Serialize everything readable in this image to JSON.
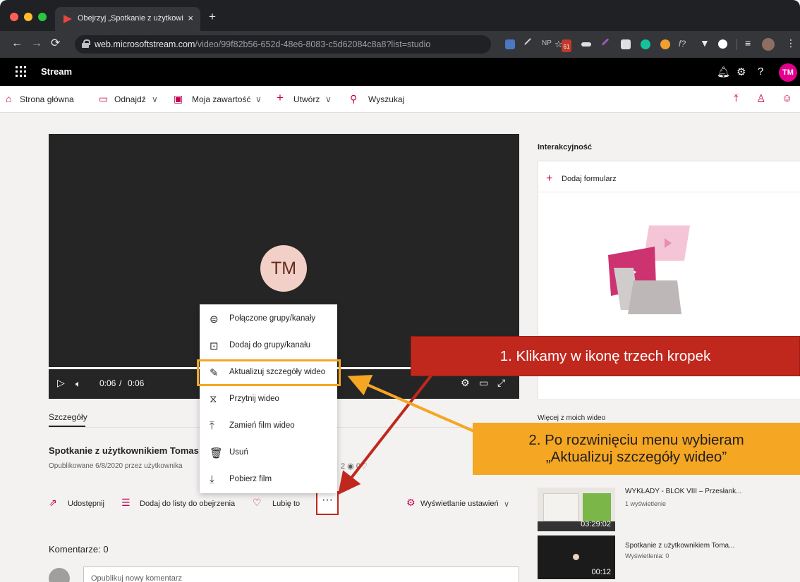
{
  "browser": {
    "tab_title": "Obejrzyj „Spotkanie z użytkowi",
    "tab_close": "×",
    "new_tab": "+",
    "url_host": "web.microsoftstream.com",
    "url_path": "/video/99f82b56-652d-48e6-8083-c5d62084c8a8?list=studio",
    "ext_np": "NP",
    "ext_badge": "61",
    "ext_f": "f?"
  },
  "appbar": {
    "app_name": "Stream",
    "avatar_initials": "TM"
  },
  "nav": {
    "home": "Strona główna",
    "discover": "Odnajdź",
    "my_content": "Moja zawartość",
    "create": "Utwórz",
    "search": "Wyszukaj"
  },
  "player": {
    "avatar_initials": "TM",
    "time_current": "0:06",
    "time_sep": "/",
    "time_total": "0:06",
    "progress": 1.0
  },
  "details": {
    "tab_label": "Szczegóły",
    "title": "Spotkanie z użytkownikiem Tomas",
    "published": "Opublikowane 6/8/2020 przez użytkownika",
    "views": "2",
    "likes": "0"
  },
  "actions": {
    "share": "Udostępnij",
    "watchlist": "Dodaj do listy do obejrzenia",
    "like": "Lubię to",
    "more": "···",
    "playback_settings": "Wyświetlanie ustawień"
  },
  "comments": {
    "title": "Komentarze: 0",
    "placeholder": "Opublikuj nowy komentarz"
  },
  "interactivity": {
    "title": "Interakcyjność",
    "add_form": "Dodaj formularz"
  },
  "more_videos": {
    "title": "Więcej z moich wideo",
    "items": [
      {
        "title": "WYKŁADY - BLOK VIII – Przesłank...",
        "meta": "1 wyświetlenie",
        "duration": "03:29:02"
      },
      {
        "title": "Spotkanie z użytkownikiem Toma...",
        "meta": "Wyświetlenia: 0",
        "duration": "00:12"
      }
    ]
  },
  "context_menu": {
    "items": [
      {
        "label": "Połączone grupy/kanały",
        "icon": "globe-icon"
      },
      {
        "label": "Dodaj do grupy/kanału",
        "icon": "add-to-group-icon"
      },
      {
        "label": "Aktualizuj szczegóły wideo",
        "icon": "pencil-icon"
      },
      {
        "label": "Przytnij wideo",
        "icon": "trim-icon"
      },
      {
        "label": "Zamień film wideo",
        "icon": "replace-icon"
      },
      {
        "label": "Usuń",
        "icon": "trash-icon"
      },
      {
        "label": "Pobierz film",
        "icon": "download-icon"
      }
    ]
  },
  "annotations": {
    "step1": "1. Klikamy w ikonę trzech kropek",
    "step2_line1": "2. Po rozwinięciu menu wybieram",
    "step2_line2": "„Aktualizuj szczegóły wideo”"
  },
  "colors": {
    "accent": "#c30052",
    "callout_red": "#c0281e",
    "callout_orange": "#f5a623"
  }
}
